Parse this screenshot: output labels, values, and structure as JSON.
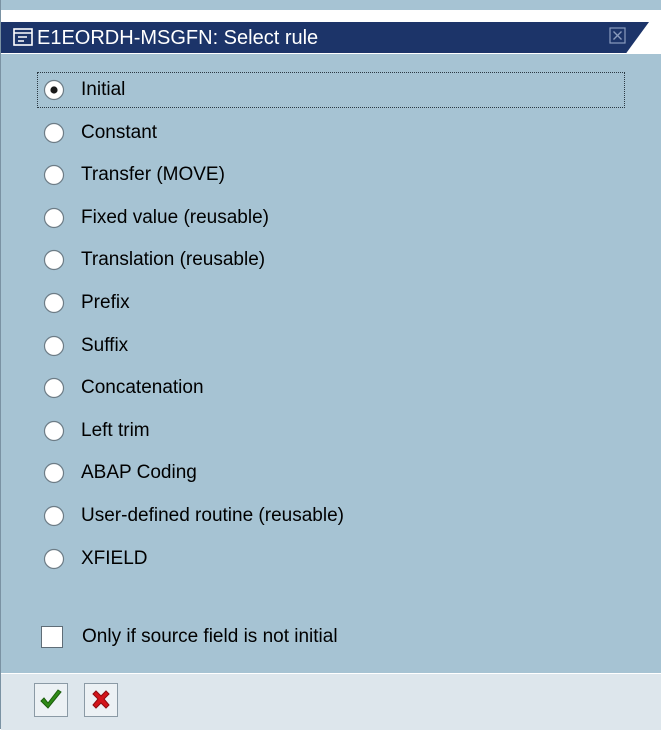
{
  "dialog": {
    "title": "E1EORDH-MSGFN: Select rule"
  },
  "rules": {
    "selected": "Initial",
    "options": [
      "Initial",
      "Constant",
      "Transfer (MOVE)",
      "Fixed value (reusable)",
      "Translation (reusable)",
      "Prefix",
      "Suffix",
      "Concatenation",
      "Left trim",
      "ABAP Coding",
      "User-defined routine (reusable)",
      "XFIELD"
    ]
  },
  "condition": {
    "label": "Only if source field is not initial",
    "checked": false
  },
  "colors": {
    "title_bar": "#1c3469",
    "dialog_background": "#a6c3d3",
    "confirm_icon": "#2f8a16",
    "cancel_icon": "#d4141a"
  },
  "icons": {
    "window": "window-icon",
    "close": "close-icon",
    "confirm": "checkmark-icon",
    "cancel": "red-x-icon"
  }
}
